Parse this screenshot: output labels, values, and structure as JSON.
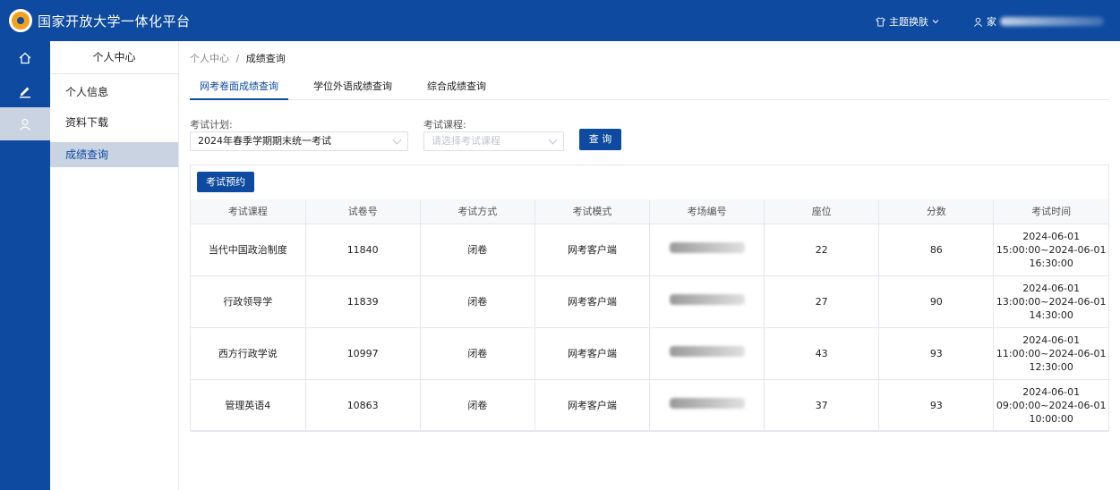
{
  "app": {
    "title": "国家开放大学一体化平台"
  },
  "topbar": {
    "theme_label": "主题换肤",
    "user_label": "家"
  },
  "menu": {
    "header": "个人中心",
    "items": [
      {
        "label": "个人信息",
        "active": false
      },
      {
        "label": "资料下载",
        "active": false
      },
      {
        "label": "成绩查询",
        "active": true
      }
    ]
  },
  "breadcrumb": {
    "parent": "个人中心",
    "separator": "/",
    "current": "成绩查询"
  },
  "tabs": [
    {
      "label": "网考卷面成绩查询",
      "active": true
    },
    {
      "label": "学位外语成绩查询",
      "active": false
    },
    {
      "label": "综合成绩查询",
      "active": false
    }
  ],
  "filters": {
    "plan_label": "考试计划:",
    "plan_value": "2024年春季学期期末统一考试",
    "course_label": "考试课程:",
    "course_placeholder": "请选择考试课程",
    "query_button": "查 询"
  },
  "reserve_button": "考试预约",
  "table": {
    "columns": [
      "考试课程",
      "试卷号",
      "考试方式",
      "考试模式",
      "考场编号",
      "座位",
      "分数",
      "考试时间"
    ],
    "rows": [
      {
        "course": "当代中国政治制度",
        "paper_no": "11840",
        "method": "闭卷",
        "mode": "网考客户端",
        "seat": "22",
        "score": "86",
        "time_l1": "2024-06-01",
        "time_l2": "15:00:00~2024-06-01",
        "time_l3": "16:30:00"
      },
      {
        "course": "行政领导学",
        "paper_no": "11839",
        "method": "闭卷",
        "mode": "网考客户端",
        "seat": "27",
        "score": "90",
        "time_l1": "2024-06-01",
        "time_l2": "13:00:00~2024-06-01",
        "time_l3": "14:30:00"
      },
      {
        "course": "西方行政学说",
        "paper_no": "10997",
        "method": "闭卷",
        "mode": "网考客户端",
        "seat": "43",
        "score": "93",
        "time_l1": "2024-06-01",
        "time_l2": "11:00:00~2024-06-01",
        "time_l3": "12:30:00"
      },
      {
        "course": "管理英语4",
        "paper_no": "10863",
        "method": "闭卷",
        "mode": "网考客户端",
        "seat": "37",
        "score": "93",
        "time_l1": "2024-06-01",
        "time_l2": "09:00:00~2024-06-01",
        "time_l3": "10:00:00"
      }
    ]
  },
  "colors": {
    "primary": "#0d4aa0",
    "accent": "#f2a21c",
    "active_bg": "#c9d3e2"
  }
}
